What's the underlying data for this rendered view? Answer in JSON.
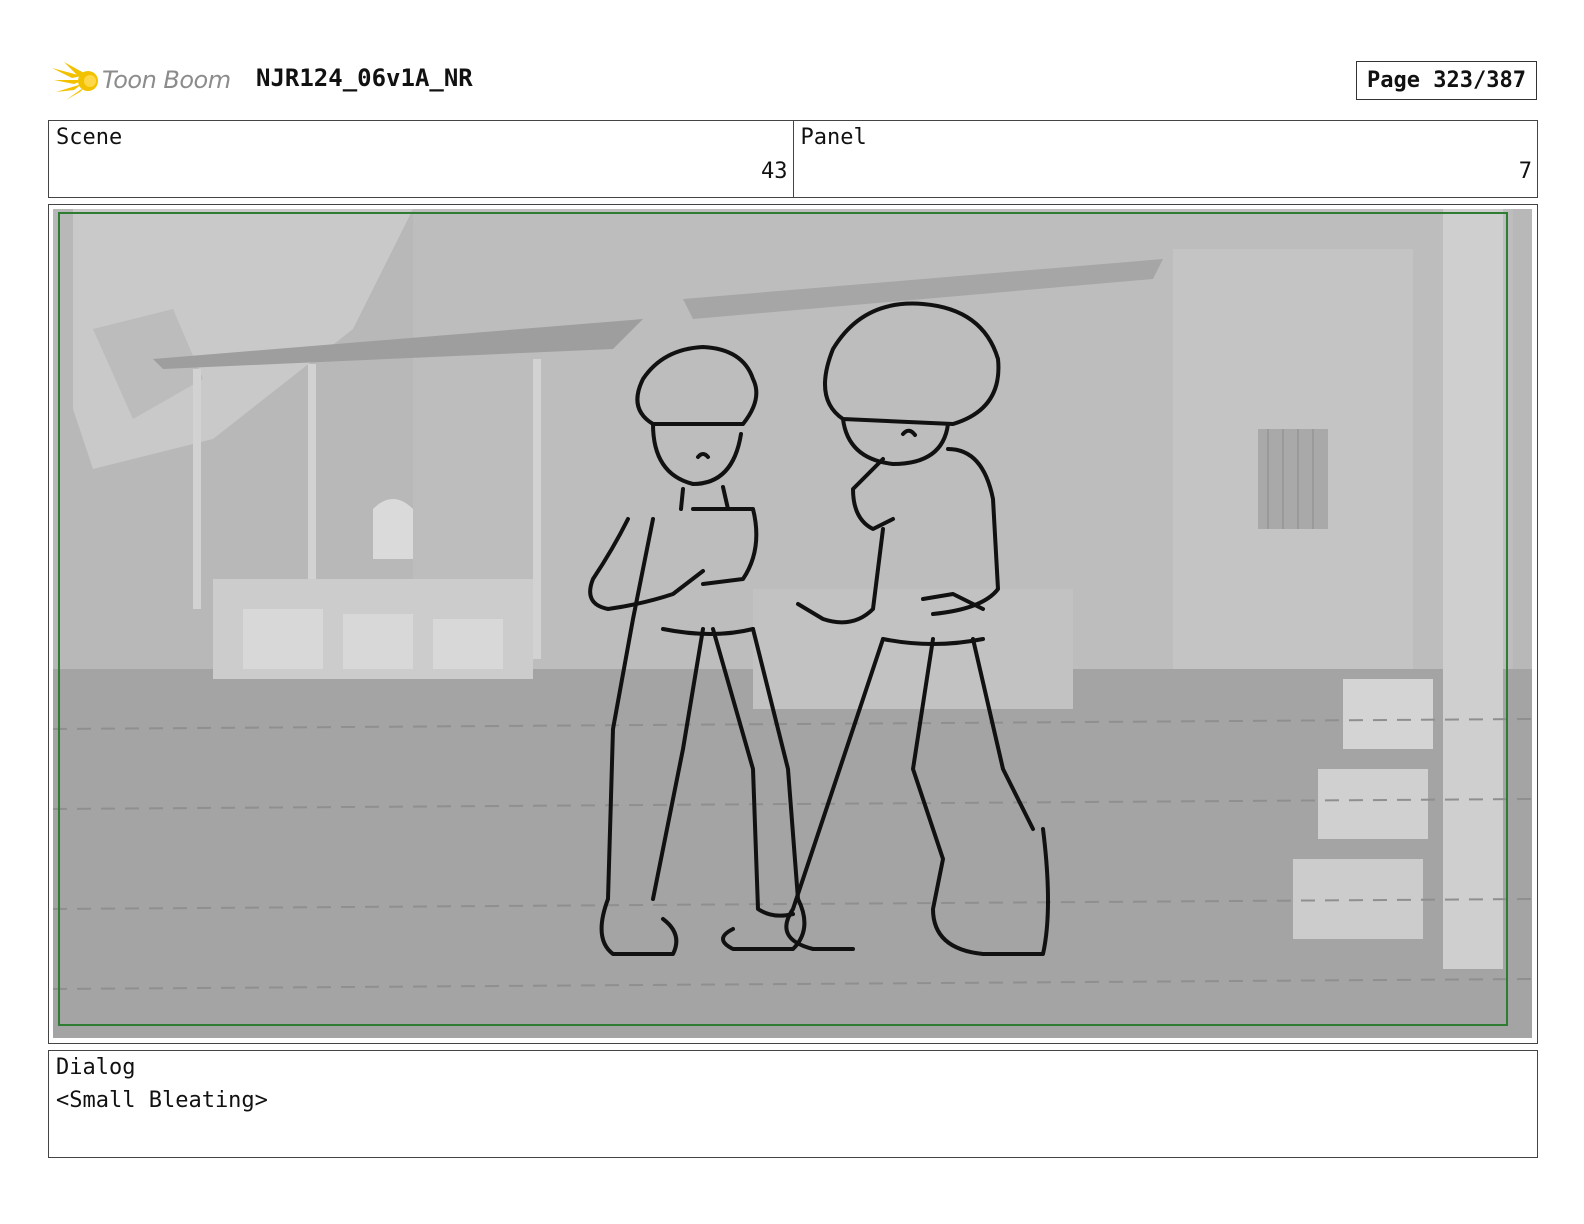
{
  "header": {
    "logo_text": "Toon Boom",
    "doc_title": "NJR124_06v1A_NR",
    "page_label": "Page 323/387"
  },
  "info": {
    "scene_label": "Scene",
    "scene_value": "43",
    "panel_label": "Panel",
    "panel_value": "7"
  },
  "dialog": {
    "label": "Dialog",
    "text": "<Small Bleating>"
  },
  "colors": {
    "logo_star": "#f2c200",
    "frame_border": "#2e7d32",
    "background_gray": "#b4b4b4"
  }
}
